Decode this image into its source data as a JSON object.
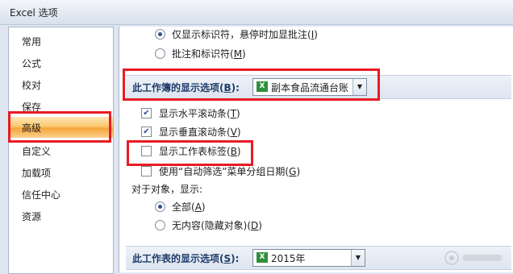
{
  "window": {
    "title": "Excel 选项"
  },
  "sidebar": {
    "items": [
      {
        "label": "常用"
      },
      {
        "label": "公式"
      },
      {
        "label": "校对"
      },
      {
        "label": "保存"
      },
      {
        "label": "高级"
      },
      {
        "label": "自定义"
      },
      {
        "label": "加载项"
      },
      {
        "label": "信任中心"
      },
      {
        "label": "资源"
      }
    ],
    "active_index": 4
  },
  "comments": {
    "option_indicators_only": {
      "text": "仅显示标识符，悬停时加显批注(",
      "key": "I",
      "tail": ")",
      "selected": true
    },
    "option_comments_and_indicators": {
      "text": "批注和标识符(",
      "key": "M",
      "tail": ")",
      "selected": false
    }
  },
  "workbook_section": {
    "label": "此工作簿的显示选项(",
    "key": "B",
    "tail": "):",
    "selected_workbook": "副本食品流通台账",
    "options": [
      {
        "text": "显示水平滚动条(",
        "key": "T",
        "tail": ")",
        "checked": true
      },
      {
        "text": "显示垂直滚动条(",
        "key": "V",
        "tail": ")",
        "checked": true
      },
      {
        "text": "显示工作表标签(",
        "key": "B",
        "tail": ")",
        "checked": false
      },
      {
        "text": "使用“自动筛选”菜单分组日期(",
        "key": "G",
        "tail": ")",
        "checked": false
      }
    ],
    "objects_label": "对于对象，显示:",
    "objects_all": {
      "text": "全部(",
      "key": "A",
      "tail": ")",
      "selected": true
    },
    "objects_none": {
      "text": "无内容(隐藏对象)(",
      "key": "D",
      "tail": ")",
      "selected": false
    }
  },
  "worksheet_section": {
    "label": "此工作表的显示选项(",
    "key": "S",
    "tail": "):",
    "selected_sheet": "2015年"
  },
  "icons": {
    "workbook_file": "excel-workbook-icon",
    "sheet_file": "excel-sheet-icon",
    "dropdown": "chevron-down-icon"
  },
  "colors": {
    "highlight": "#e81b24",
    "active_nav": "#fbc870",
    "section_text": "#1f3b69"
  }
}
